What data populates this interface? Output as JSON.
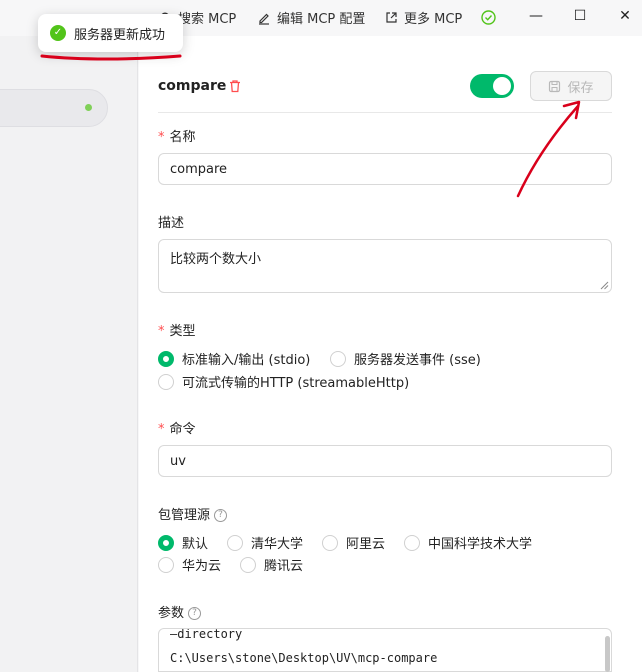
{
  "toolbar": {
    "search_label": "搜索 MCP",
    "edit_label": "编辑 MCP 配置",
    "more_label": "更多 MCP"
  },
  "window_controls": {
    "minimize": "—",
    "maximize": "☐",
    "close": "✕"
  },
  "toast": {
    "message": "服务器更新成功"
  },
  "server": {
    "name": "compare",
    "enabled": true,
    "save_label": "保存"
  },
  "form": {
    "name": {
      "label": "名称",
      "value": "compare"
    },
    "description": {
      "label": "描述",
      "value": "比较两个数大小"
    },
    "type": {
      "label": "类型",
      "options": [
        "标准输入/输出 (stdio)",
        "服务器发送事件 (sse)",
        "可流式传输的HTTP (streamableHttp)"
      ],
      "selected": "标准输入/输出 (stdio)"
    },
    "command": {
      "label": "命令",
      "value": "uv"
    },
    "package_source": {
      "label": "包管理源",
      "options": [
        "默认",
        "清华大学",
        "阿里云",
        "中国科学技术大学",
        "华为云",
        "腾讯云"
      ],
      "selected": "默认"
    },
    "args": {
      "label": "参数",
      "lines": [
        "—directory",
        "C:\\Users\\stone\\Desktop\\UV\\mcp-compare"
      ]
    }
  },
  "colors": {
    "accent": "#00b96b",
    "required": "#ff4d4f",
    "success": "#52c41a",
    "annotation": "#d9001b"
  }
}
